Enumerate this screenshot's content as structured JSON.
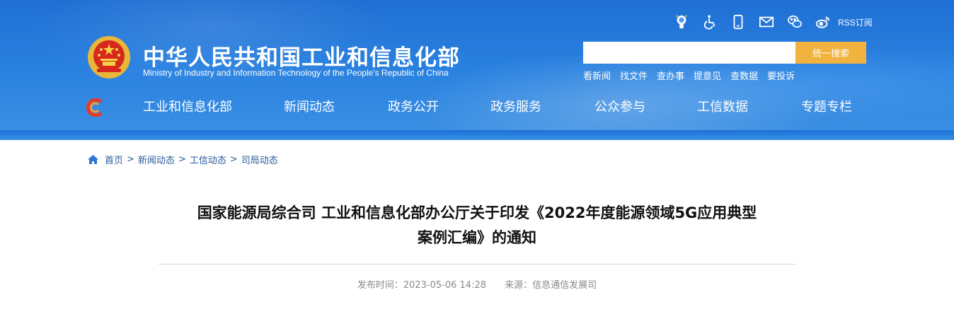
{
  "header": {
    "title_cn": "中华人民共和国工业和信息化部",
    "title_en": "Ministry of Industry and Information Technology of the People's Republic of China",
    "toolbar": {
      "icons": [
        "ai-assistant-icon",
        "accessibility-icon",
        "mobile-icon",
        "mail-icon",
        "wechat-icon",
        "weibo-icon"
      ],
      "rss_label": "RSS订阅"
    },
    "search": {
      "placeholder": "",
      "button_label": "统一搜索"
    },
    "quick_links": [
      "看新闻",
      "找文件",
      "查办事",
      "提意见",
      "查数据",
      "要投诉"
    ],
    "nav": [
      "工业和信息化部",
      "新闻动态",
      "政务公开",
      "政务服务",
      "公众参与",
      "工信数据",
      "专题专栏"
    ]
  },
  "breadcrumb": {
    "items": [
      "首页",
      "新闻动态",
      "工信动态",
      "司局动态"
    ],
    "separator": ">"
  },
  "article": {
    "title_line1": "国家能源局综合司 工业和信息化部办公厅关于印发《2022年度能源领域5G应用典型",
    "title_line2": "案例汇编》的通知",
    "published": "发布时间：2023-05-06 14:28",
    "source": "来源：信息通信发展司"
  },
  "colors": {
    "header_blue": "#2a82e0",
    "search_button": "#f2b23e",
    "breadcrumb_link": "#2a5a9a",
    "meta_gray": "#8a8a8a"
  }
}
